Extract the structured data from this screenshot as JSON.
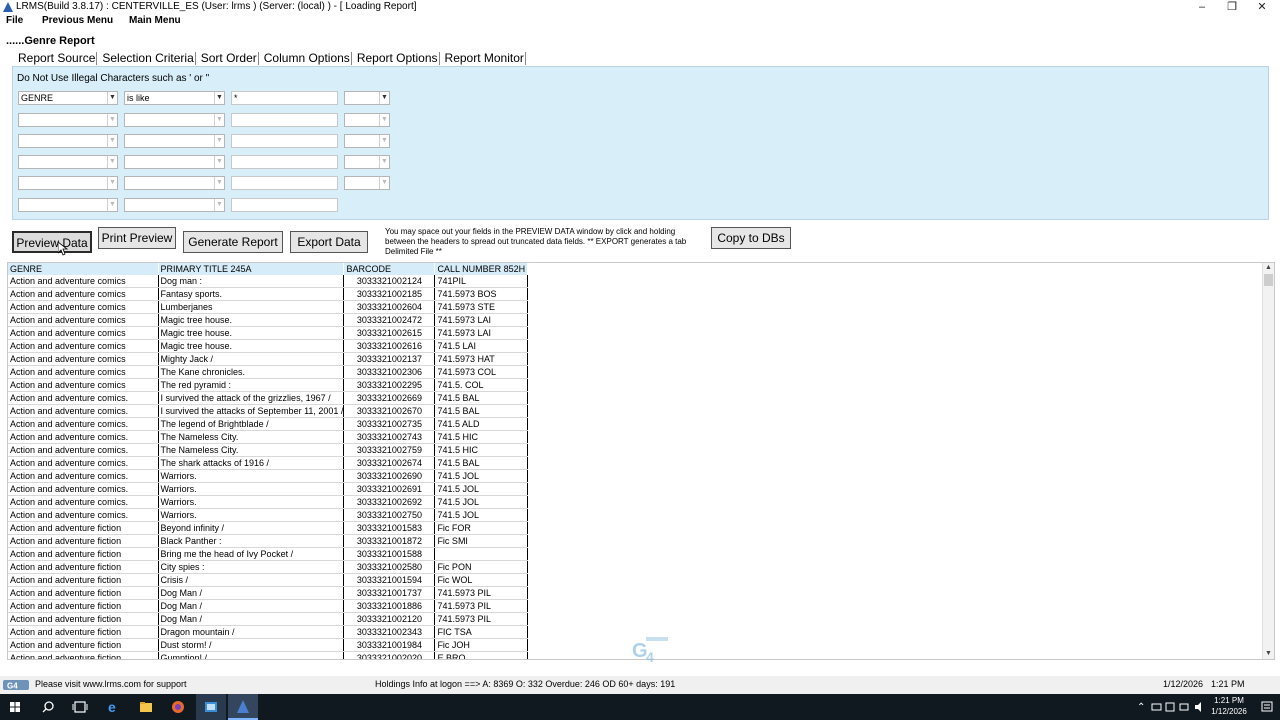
{
  "window": {
    "title": "LRMS(Build 3.8.17) : CENTERVILLE_ES (User: lrms ) (Server: (local) ) - [ Loading Report]",
    "minimize": "–",
    "restore": "❐",
    "close": "✕"
  },
  "menu": [
    "File",
    "Previous Menu",
    "Main Menu"
  ],
  "report_heading": "......Genre Report",
  "tabs": [
    "Report Source",
    "Selection Criteria",
    "Sort Order",
    "Column Options",
    "Report Options",
    "Report Monitor"
  ],
  "criteria": {
    "warning": "Do Not Use Illegal Characters such as ' or \"",
    "rows": [
      {
        "field": "GENRE",
        "operator": "is like",
        "value": "*",
        "connector": "",
        "has_connector": true
      },
      {
        "field": "",
        "operator": "",
        "value": "",
        "connector": "",
        "has_connector": true
      },
      {
        "field": "",
        "operator": "",
        "value": "",
        "connector": "",
        "has_connector": true
      },
      {
        "field": "",
        "operator": "",
        "value": "",
        "connector": "",
        "has_connector": true
      },
      {
        "field": "",
        "operator": "",
        "value": "",
        "connector": "",
        "has_connector": true
      },
      {
        "field": "",
        "operator": "",
        "value": "",
        "connector": "",
        "has_connector": false
      }
    ]
  },
  "buttons": {
    "preview": "Preview Data",
    "print_preview": "Print Preview",
    "generate": "Generate Report",
    "export": "Export Data",
    "copy": "Copy to DBs"
  },
  "hint": "You may space out your fields in the PREVIEW DATA window by click and holding between the headers to spread out truncated data fields. ** EXPORT generates a tab Delimited File **",
  "table": {
    "columns": [
      "GENRE",
      "PRIMARY TITLE 245A",
      "BARCODE",
      "CALL NUMBER 852H"
    ],
    "rows": [
      [
        "Action and adventure comics",
        "Dog man :",
        "3033321002124",
        "741PIL"
      ],
      [
        "Action and adventure comics",
        "Fantasy sports.",
        "3033321002185",
        "741.5973 BOS"
      ],
      [
        "Action and adventure comics",
        "Lumberjanes",
        "3033321002604",
        "741.5973 STE"
      ],
      [
        "Action and adventure comics",
        "Magic tree house.",
        "3033321002472",
        "741.5973 LAI"
      ],
      [
        "Action and adventure comics",
        "Magic tree house.",
        "3033321002615",
        "741.5973 LAI"
      ],
      [
        "Action and adventure comics",
        "Magic tree house.",
        "3033321002616",
        "741.5 LAI"
      ],
      [
        "Action and adventure comics",
        "Mighty Jack /",
        "3033321002137",
        "741.5973 HAT"
      ],
      [
        "Action and adventure comics",
        "The Kane chronicles.",
        "3033321002306",
        "741.5973 COL"
      ],
      [
        "Action and adventure comics",
        "The red pyramid :",
        "3033321002295",
        "741.5. COL"
      ],
      [
        "Action and adventure comics.",
        "I survived the attack of the grizzlies, 1967 /",
        "3033321002669",
        "741.5 BAL"
      ],
      [
        "Action and adventure comics.",
        "I survived the attacks of September 11, 2001 /",
        "3033321002670",
        "741.5 BAL"
      ],
      [
        "Action and adventure comics.",
        "The legend of Brightblade /",
        "3033321002735",
        "741.5 ALD"
      ],
      [
        "Action and adventure comics.",
        "The Nameless City.",
        "3033321002743",
        "741.5 HIC"
      ],
      [
        "Action and adventure comics.",
        "The Nameless City.",
        "3033321002759",
        "741.5 HIC"
      ],
      [
        "Action and adventure comics.",
        "The shark attacks of 1916 /",
        "3033321002674",
        "741.5 BAL"
      ],
      [
        "Action and adventure comics.",
        "Warriors.",
        "3033321002690",
        "741.5 JOL"
      ],
      [
        "Action and adventure comics.",
        "Warriors.",
        "3033321002691",
        "741.5 JOL"
      ],
      [
        "Action and adventure comics.",
        "Warriors.",
        "3033321002692",
        "741.5 JOL"
      ],
      [
        "Action and adventure comics.",
        "Warriors.",
        "3033321002750",
        "741.5 JOL"
      ],
      [
        "Action and adventure fiction",
        "Beyond infinity /",
        "3033321001583",
        "Fic FOR"
      ],
      [
        "Action and adventure fiction",
        "Black Panther :",
        "3033321001872",
        "Fic SMI"
      ],
      [
        "Action and adventure fiction",
        "Bring me the head of Ivy Pocket /",
        "3033321001588",
        ""
      ],
      [
        "Action and adventure fiction",
        "City spies :",
        "3033321002580",
        "Fic PON"
      ],
      [
        "Action and adventure fiction",
        "Crisis /",
        "3033321001594",
        "Fic WOL"
      ],
      [
        "Action and adventure fiction",
        "Dog Man /",
        "3033321001737",
        "741.5973 PIL"
      ],
      [
        "Action and adventure fiction",
        "Dog Man /",
        "3033321001886",
        "741.5973 PIL"
      ],
      [
        "Action and adventure fiction",
        "Dog Man /",
        "3033321002120",
        "741.5973 PIL"
      ],
      [
        "Action and adventure fiction",
        "Dragon mountain /",
        "3033321002343",
        "FIC TSA"
      ],
      [
        "Action and adventure fiction",
        "Dust storm! /",
        "3033321001984",
        "Fic JOH"
      ],
      [
        "Action and adventure fiction",
        "Gumption! /",
        "3033321002020",
        "E BRO"
      ]
    ]
  },
  "status": {
    "support": "Please visit www.lrms.com for support",
    "holdings": "Holdings Info at logon ==> A: 8369 O: 332  Overdue: 246 OD 60+ days: 191",
    "date": "1/12/2026",
    "time": "1:21 PM"
  },
  "taskbar": {
    "time": "1:21 PM",
    "date": "1/12/2026"
  },
  "colors": {
    "panel": "#d8eef8",
    "header": "#d6ecf8",
    "taskbar": "#101820"
  }
}
